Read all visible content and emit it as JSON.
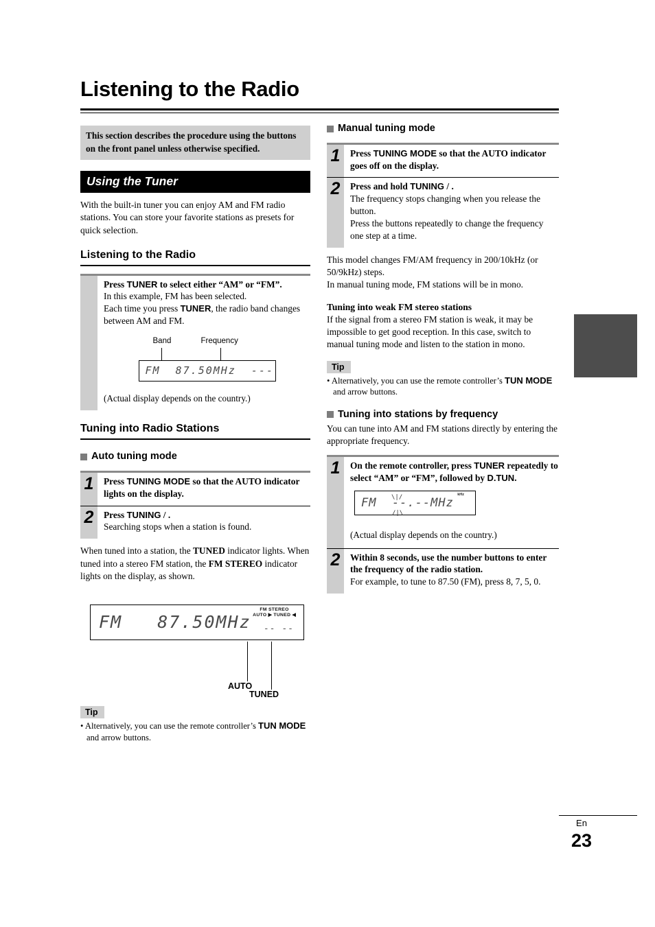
{
  "page": {
    "title": "Listening to the Radio",
    "footer_lang": "En",
    "footer_number": "23",
    "edge_tab_color": "#4d4d4d"
  },
  "left": {
    "grey_note": "This section describes the procedure using the buttons on the front panel unless otherwise specified.",
    "banner": "Using the Tuner",
    "intro": "With the built-in tuner you can enjoy AM and FM radio stations. You can store your favorite stations as presets for quick selection.",
    "sub_head": "Listening to the Radio",
    "step_box_1": {
      "number": "",
      "title_a": "Press ",
      "title_b": "TUNER",
      "title_c": " to select either “AM” or “FM”.",
      "line2": "In this example, FM has been selected.",
      "line3_a": "Each time you press ",
      "line3_b": "TUNER",
      "line3_c": ", the radio band changes between AM and FM.",
      "label_band": "Band",
      "label_frequency": "Frequency",
      "display_text": "FM  87.50MHz  ---",
      "caption": "(Actual display depends on the country.)"
    },
    "sub_head_2": "Tuning into Radio Stations",
    "sq_head_auto": "Auto tuning mode",
    "steps_auto": [
      {
        "number": "1",
        "title_a": "Press ",
        "title_b": "TUNING MODE",
        "title_c": " so that the AUTO indicator lights on the display.",
        "text": ""
      },
      {
        "number": "2",
        "title_a": "Press ",
        "title_b": "TUNING",
        "title_c": "   /  .",
        "text": "Searching stops when a station is found."
      }
    ],
    "after_steps_a": "When tuned into a station, the ",
    "after_steps_b": "TUNED",
    "after_steps_c": " indicator lights. When tuned into a stereo FM station, the ",
    "after_steps_d": "FM STEREO",
    "after_steps_e": " indicator lights on the display, as shown.",
    "big_display": {
      "callout_fm_stereo": "FM STEREO",
      "callout_auto": "AUTO",
      "callout_tuned": "TUNED",
      "indicator_line1": "FM STEREO",
      "indicator_line2": "AUTO  ▶ TUNED ◀",
      "text": "FM   87.50MHz",
      "dashes": "-- --"
    },
    "tip": {
      "label": "Tip",
      "text_a": "• Alternatively, you can use the remote controller’s ",
      "text_b": "TUN MODE",
      "text_c": " and arrow buttons."
    }
  },
  "right": {
    "sq_head_manual": "Manual tuning mode",
    "steps_manual": [
      {
        "number": "1",
        "title_a": "Press ",
        "title_b": "TUNING MODE",
        "title_c": " so that the AUTO indicator goes off on the display.",
        "text": ""
      },
      {
        "number": "2",
        "title_a": "Press and hold ",
        "title_b": "TUNING",
        "title_c": "   /  .",
        "text": "The frequency stops changing when you release the button.\nPress the buttons repeatedly to change the frequency one step at a time."
      }
    ],
    "para_model": "This model changes FM/AM frequency in 200/10kHz (or 50/9kHz) steps.",
    "para_mono": "In manual tuning mode, FM stations will be in mono.",
    "runin_weak": "Tuning into weak FM stereo stations",
    "para_weak": "If the signal from a stereo FM station is weak, it may be impossible to get good reception. In this case, switch to manual tuning mode and listen to the station in mono.",
    "tip": {
      "label": "Tip",
      "text_a": "• Alternatively, you can use the remote controller’s ",
      "text_b": "TUN MODE",
      "text_c": " and arrow buttons."
    },
    "sq_head_byfreq": "Tuning into stations by frequency",
    "para_byfreq": "You can tune into AM and FM stations directly by entering the appropriate frequency.",
    "steps_freq": [
      {
        "number": "1",
        "title_a": "On the remote controller, press ",
        "title_b": "TUNER",
        "title_c": " repeatedly to select “AM” or “FM”, followed by ",
        "title_d": "D.TUN",
        "title_e": ".",
        "display_text": "FM  --.--MHz",
        "display_tiny": "kHz",
        "caption": "(Actual display depends on the country.)"
      },
      {
        "number": "2",
        "title": "Within 8 seconds, use the number buttons to enter the frequency of the radio station.",
        "text": "For example, to tune to 87.50 (FM), press 8, 7, 5, 0."
      }
    ]
  }
}
